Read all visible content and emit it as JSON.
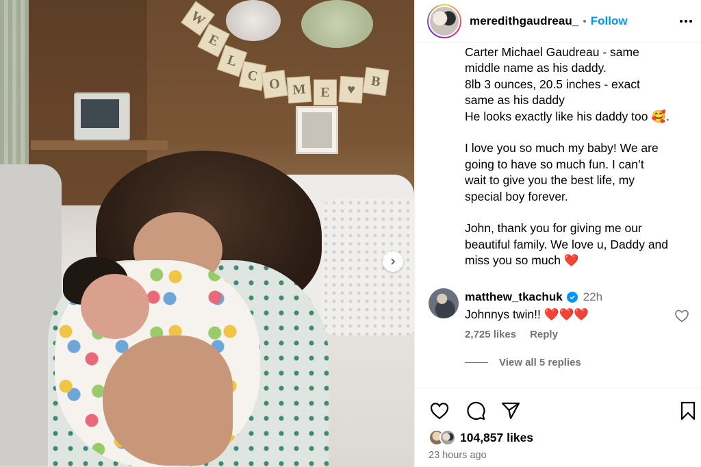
{
  "post": {
    "username": "meredithgaudreau_",
    "separator": "•",
    "follow_label": "Follow",
    "caption_paragraphs": [
      [
        "Carter Michael Gaudreau - same",
        "middle name as his daddy.",
        "8lb 3 ounces, 20.5 inches - exact",
        "same as his daddy",
        "He looks exactly like his daddy too 🥰."
      ],
      [
        "I love you so much my baby! We are",
        "going to have so much fun. I can’t",
        "wait to give you the best life, my",
        "special boy forever."
      ],
      [
        "John, thank you for giving me our",
        "beautiful family. We love u, Daddy and",
        "miss you so much ❤️"
      ]
    ],
    "banner_letters": [
      "W",
      "E",
      "L",
      "C",
      "O",
      "M",
      "E",
      "♥",
      "B"
    ]
  },
  "comment": {
    "username": "matthew_tkachuk",
    "time": "22h",
    "text": "Johnnys twin!! ❤️❤️❤️",
    "likes": "2,725 likes",
    "reply_label": "Reply",
    "view_replies": "View all 5 replies"
  },
  "footer": {
    "likes_count": "104,857 likes",
    "time_ago": "23 hours ago"
  },
  "icons": {
    "more": "more-options-icon",
    "verified": "verified-badge-icon",
    "comment_like": "heart-outline-icon",
    "like": "heart-outline-icon",
    "comment": "comment-bubble-icon",
    "share": "paper-plane-icon",
    "save": "bookmark-icon",
    "carousel": "chevron-right-icon"
  },
  "colors": {
    "link_blue": "#0095f6",
    "secondary_text": "#737373",
    "heart_red": "#ed4956"
  }
}
